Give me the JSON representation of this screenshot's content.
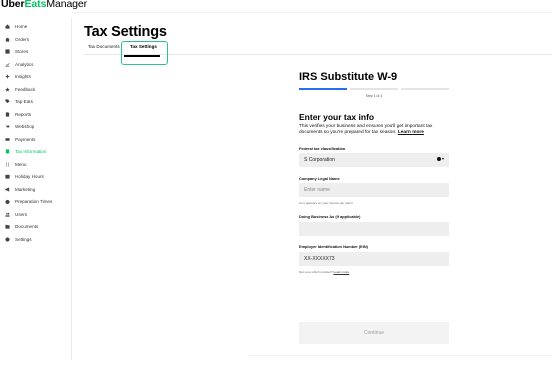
{
  "app": {
    "logo_part1": "Uber",
    "logo_part2": "Eats",
    "logo_part3": "Manager",
    "accent_color": "#06c167"
  },
  "sidebar": {
    "items": [
      {
        "label": "Home",
        "icon": "home-icon"
      },
      {
        "label": "Orders",
        "icon": "bag-icon"
      },
      {
        "label": "Stores",
        "icon": "store-icon"
      },
      {
        "label": "Analytics",
        "icon": "chart-icon"
      },
      {
        "label": "Insights",
        "icon": "sparkle-icon"
      },
      {
        "label": "Feedback",
        "icon": "star-icon"
      },
      {
        "label": "Tap Eats",
        "icon": "tag-icon"
      },
      {
        "label": "Reports",
        "icon": "document-icon"
      },
      {
        "label": "Webshop",
        "icon": "cart-icon"
      },
      {
        "label": "Payments",
        "icon": "card-icon"
      },
      {
        "label": "Tax Information",
        "icon": "receipt-icon",
        "active": true
      },
      {
        "label": "Menu",
        "icon": "fork-knife-icon"
      },
      {
        "label": "Holiday Hours",
        "icon": "calendar-icon"
      },
      {
        "label": "Marketing",
        "icon": "megaphone-icon"
      },
      {
        "label": "Preparation Times",
        "icon": "timer-icon"
      },
      {
        "label": "Users",
        "icon": "users-icon"
      },
      {
        "label": "Documents",
        "icon": "folder-icon"
      },
      {
        "label": "Settings",
        "icon": "gear-icon"
      }
    ]
  },
  "main": {
    "title": "Tax Settings",
    "tabs": [
      {
        "label": "Tax Documents"
      },
      {
        "label": "Tax Settings",
        "selected": true
      }
    ]
  },
  "form": {
    "title": "IRS Substitute W-9",
    "progress": {
      "step": 1,
      "total": 3,
      "label": "Step 1 of 3"
    },
    "heading": "Enter your tax info",
    "description": "This verifies your business and ensures you'll get important tax documents so you're prepared for tax season.",
    "learn_more": "Learn more",
    "classification": {
      "label": "Federal tax classification",
      "value": "S Corporation"
    },
    "legal_name": {
      "label": "Company Legal Name",
      "placeholder": "Enter name",
      "hint": "As it appears on your income tax return"
    },
    "dba": {
      "label": "Doing Business As (if applicable)",
      "value": ""
    },
    "ein": {
      "label": "Employer Identification Number (EIN)",
      "value": "XX-XXXXX73",
      "hint": "Not sure which number?",
      "hint_link": "Learn more"
    },
    "continue_label": "Continue"
  }
}
